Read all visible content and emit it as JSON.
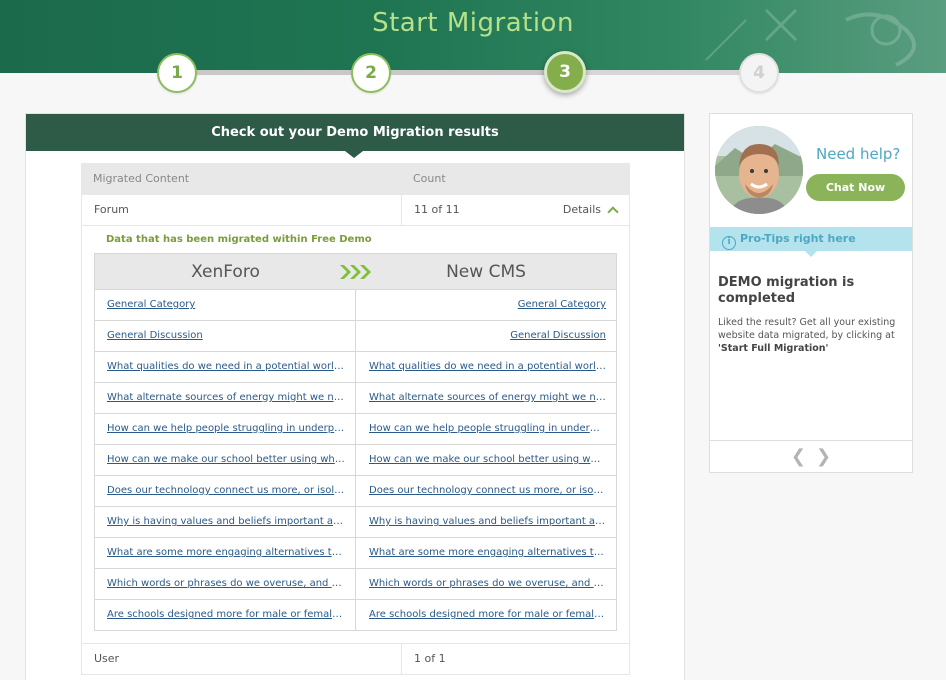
{
  "header": {
    "title": "Start Migration"
  },
  "steps": [
    {
      "label": "1",
      "state": "done"
    },
    {
      "label": "2",
      "state": "done"
    },
    {
      "label": "3",
      "state": "active"
    },
    {
      "label": "4",
      "state": "pending"
    }
  ],
  "main": {
    "heading": "Check out your Demo Migration results",
    "columns": {
      "content": "Migrated Content",
      "count": "Count"
    },
    "rows": [
      {
        "content": "Forum",
        "count": "11 of 11",
        "details_label": "Details"
      },
      {
        "content": "User",
        "count": "1 of 1"
      }
    ],
    "expanded": {
      "note": "Data that has been migrated within Free Demo",
      "source": "XenForo",
      "target": "New CMS",
      "items": [
        {
          "left": "General Category",
          "right": "General Category"
        },
        {
          "left": "General Discussion",
          "right": "General Discussion"
        },
        {
          "left": "What qualities do we need in a potential world l...",
          "right": "What qualities do we need in a potential world l..."
        },
        {
          "left": "What alternate sources of energy might we need...",
          "right": "What alternate sources of energy might we need..."
        },
        {
          "left": "How can we help people struggling in underprivi...",
          "right": "How can we help people struggling in underprivi..."
        },
        {
          "left": "How can we make our school better using what ...",
          "right": "How can we make our school better using what ..."
        },
        {
          "left": "Does our technology connect us more, or isolate...",
          "right": "Does our technology connect us more, or isolate..."
        },
        {
          "left": "Why is having values and beliefs important and ...",
          "right": "Why is having values and beliefs important and ..."
        },
        {
          "left": "What are some more engaging alternatives to h...",
          "right": "What are some more engaging alternatives to h..."
        },
        {
          "left": "Which words or phrases do we overuse, and wh...",
          "right": "Which words or phrases do we overuse, and wh..."
        },
        {
          "left": "Are schools designed more for male or female s...",
          "right": "Are schools designed more for male or female s..."
        }
      ]
    }
  },
  "sidebar": {
    "need_help": "Need help?",
    "chat_button": "Chat Now",
    "protips_label": "Pro-Tips right here",
    "info_icon": "info-icon",
    "tip_title": "DEMO migration is completed",
    "tip_body_prefix": "Liked the result? Get all your existing website data migrated, by clicking at",
    "tip_body_action": "'Start Full Migration'",
    "prev_icon": "chevron-left-icon",
    "next_icon": "chevron-right-icon"
  },
  "colors": {
    "banner": "#1f7552",
    "title": "#b6e08a",
    "accent_green": "#84ad4b",
    "panel_head": "#2e5a48",
    "help_blue": "#4da8c2",
    "link": "#2a5a8a"
  }
}
